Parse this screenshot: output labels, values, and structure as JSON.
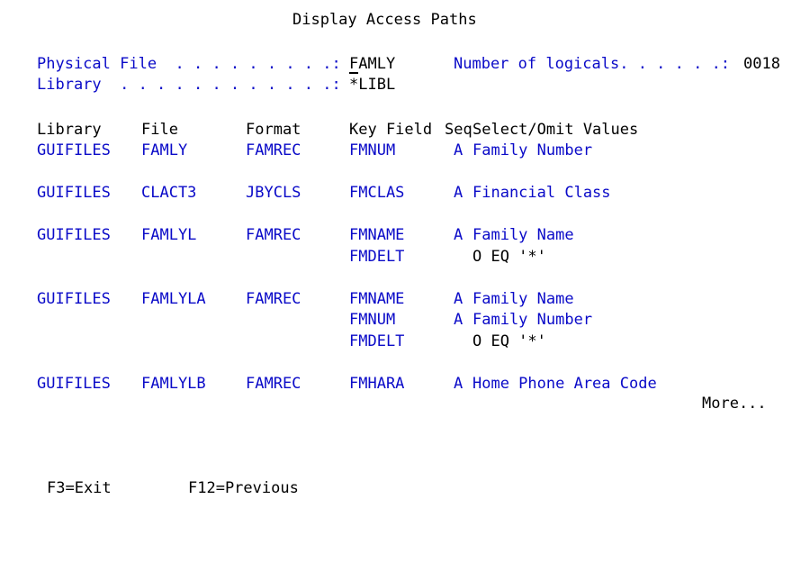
{
  "screen": {
    "title": "Display Access Paths",
    "more_indicator": "More..."
  },
  "header_fields": {
    "physical_file_label": "Physical File  . . . . . . . . .:",
    "physical_file_value": "FAMLY",
    "library_label": "Library  . . . . . . . . . . . .:",
    "library_value": "*LIBL",
    "number_of_logicals_label": "Number of logicals. . . . . .:",
    "number_of_logicals_value": "0018"
  },
  "columns": {
    "library": "Library",
    "file": "File",
    "format": "Format",
    "key_field": "Key Field",
    "seq": "Seq",
    "select_omit_values": "Select/Omit Values"
  },
  "rows": [
    {
      "library": "GUIFILES",
      "file": "FAMLY",
      "format": "FAMREC",
      "keys": [
        {
          "key_field": "FMNUM",
          "seq": "A",
          "select_omit": "Family Number",
          "seq_color": "blue",
          "value_color": "blue"
        }
      ]
    },
    {
      "library": "GUIFILES",
      "file": "CLACT3",
      "format": "JBYCLS",
      "keys": [
        {
          "key_field": "FMCLAS",
          "seq": "A",
          "select_omit": "Financial Class",
          "seq_color": "blue",
          "value_color": "blue"
        }
      ]
    },
    {
      "library": "GUIFILES",
      "file": "FAMLYL",
      "format": "FAMREC",
      "keys": [
        {
          "key_field": "FMNAME",
          "seq": "A",
          "select_omit": "Family Name",
          "seq_color": "blue",
          "value_color": "blue"
        },
        {
          "key_field": "FMDELT",
          "seq": "",
          "select_omit": "O EQ '*'",
          "seq_color": "black",
          "value_color": "black"
        }
      ]
    },
    {
      "library": "GUIFILES",
      "file": "FAMLYLA",
      "format": "FAMREC",
      "keys": [
        {
          "key_field": "FMNAME",
          "seq": "A",
          "select_omit": "Family Name",
          "seq_color": "blue",
          "value_color": "blue"
        },
        {
          "key_field": "FMNUM",
          "seq": "A",
          "select_omit": "Family Number",
          "seq_color": "blue",
          "value_color": "blue"
        },
        {
          "key_field": "FMDELT",
          "seq": "",
          "select_omit": "O EQ '*'",
          "seq_color": "black",
          "value_color": "black"
        }
      ]
    },
    {
      "library": "GUIFILES",
      "file": "FAMLYLB",
      "format": "FAMREC",
      "keys": [
        {
          "key_field": "FMHARA",
          "seq": "A",
          "select_omit": "Home Phone Area Code",
          "seq_color": "blue",
          "value_color": "blue"
        }
      ]
    }
  ],
  "function_keys": [
    {
      "label": "F3=Exit"
    },
    {
      "label": "F12=Previous"
    }
  ],
  "colors": {
    "field_blue": "#0a0ac8",
    "text_black": "#000000",
    "background": "#ffffff"
  }
}
